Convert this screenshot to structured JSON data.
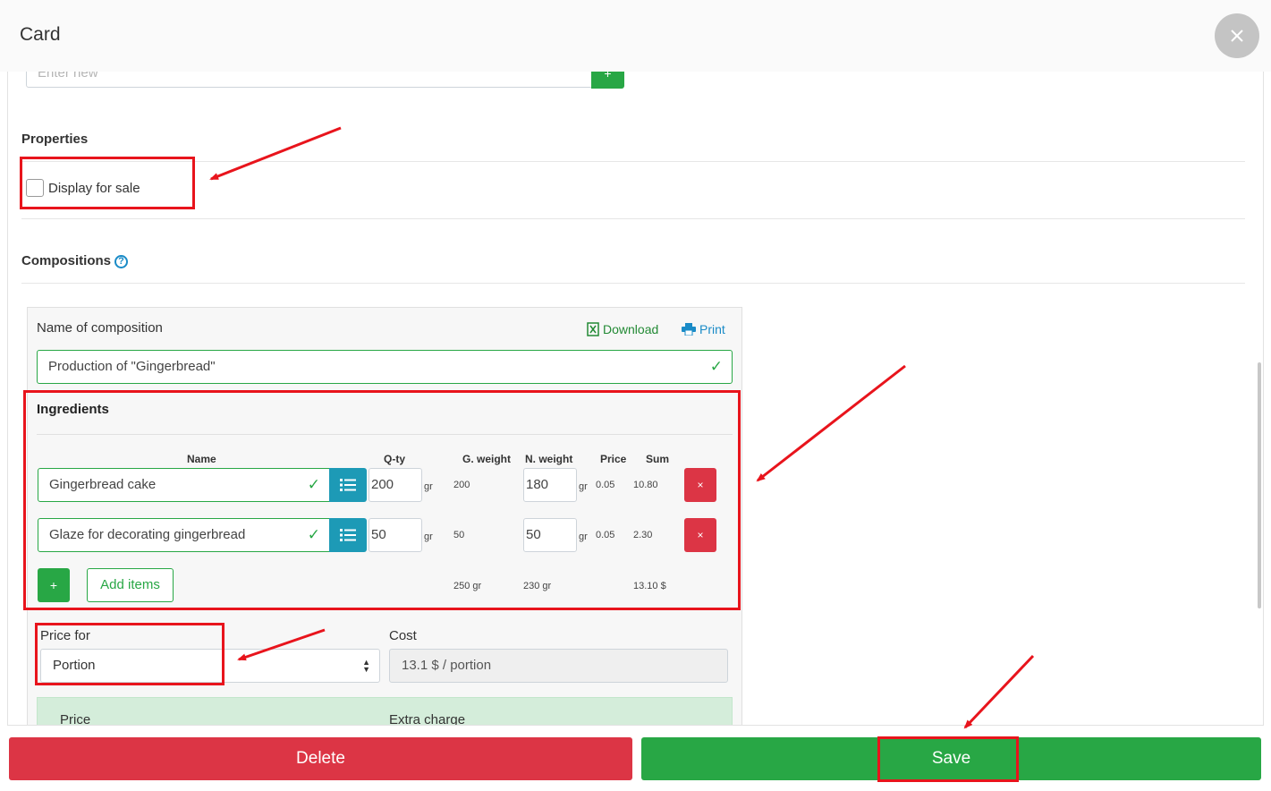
{
  "header": {
    "title": "Card"
  },
  "new_entry": {
    "placeholder": "Enter new",
    "add_label": "+"
  },
  "properties": {
    "title": "Properties",
    "display_for_sale": "Display for sale"
  },
  "compositions": {
    "title": "Compositions",
    "name_label": "Name of composition",
    "download_label": "Download",
    "print_label": "Print",
    "name_value": "Production of \"Gingerbread\"",
    "ingredients_title": "Ingredients",
    "columns": {
      "name": "Name",
      "qty": "Q-ty",
      "g_weight": "G. weight",
      "n_weight": "N. weight",
      "price": "Price",
      "sum": "Sum"
    },
    "rows": [
      {
        "name": "Gingerbread cake",
        "qty": "200",
        "qty_unit": "gr",
        "g_weight": "200",
        "n_weight": "180",
        "n_unit": "gr",
        "price": "0.05",
        "sum": "10.80",
        "delete": "×"
      },
      {
        "name": "Glaze for decorating gingerbread",
        "qty": "50",
        "qty_unit": "gr",
        "g_weight": "50",
        "n_weight": "50",
        "n_unit": "gr",
        "price": "0.05",
        "sum": "2.30",
        "delete": "×"
      }
    ],
    "add_label": "+",
    "add_items_label": "Add items",
    "totals": {
      "g_weight": "250 gr",
      "n_weight": "230 gr",
      "sum": "13.10 $"
    },
    "price_for_label": "Price for",
    "price_for_value": "Portion",
    "cost_label": "Cost",
    "cost_value": "13.1 $ / portion",
    "price_label": "Price",
    "extra_charge_label": "Extra charge"
  },
  "footer": {
    "delete_label": "Delete",
    "save_label": "Save"
  },
  "colors": {
    "success": "#28a745",
    "danger": "#dc3545",
    "info": "#1d9ab6",
    "annotation": "#e8141c"
  }
}
